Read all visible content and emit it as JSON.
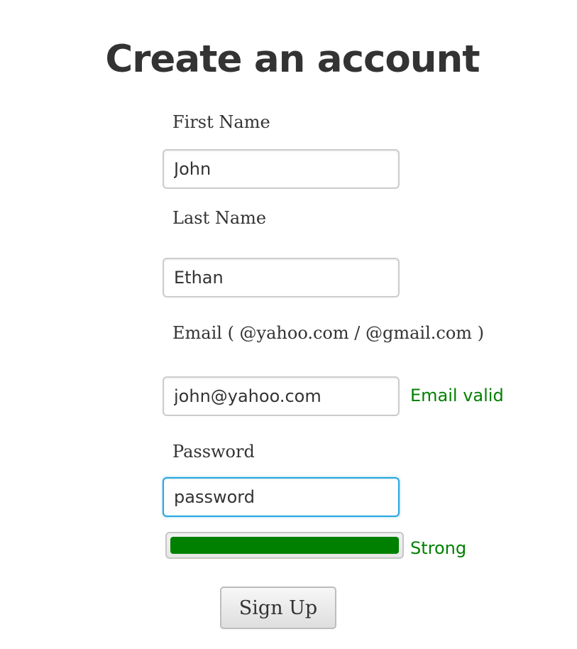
{
  "form": {
    "title": "Create an account",
    "first_name": {
      "label": "First Name",
      "value": "John"
    },
    "last_name": {
      "label": "Last Name",
      "value": "Ethan"
    },
    "email": {
      "label": "Email ( @yahoo.com / @gmail.com )",
      "value": "john@yahoo.com",
      "status": "Email valid"
    },
    "password": {
      "label": "Password",
      "value": "password",
      "strength_label": "Strong",
      "strength_percent": 100
    },
    "submit_label": "Sign Up"
  },
  "colors": {
    "status_ok": "#008000",
    "focus_border": "#28a8e0",
    "text": "#333333"
  }
}
